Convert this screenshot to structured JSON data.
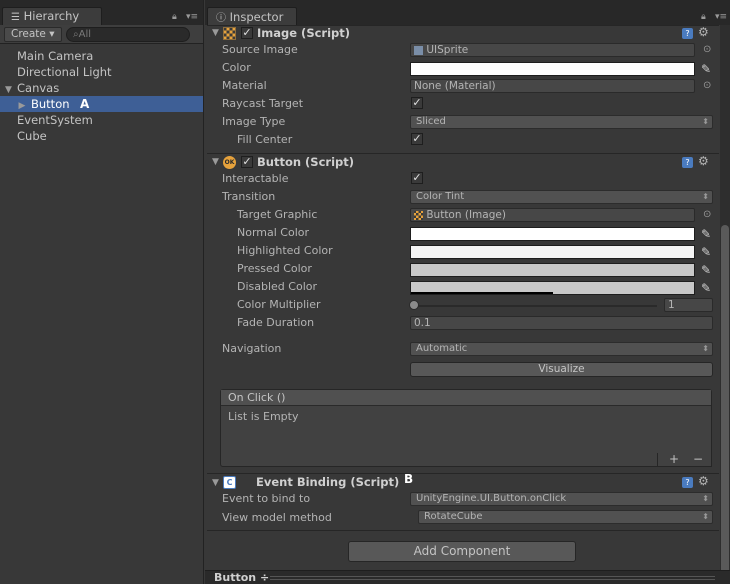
{
  "hierarchy": {
    "tab_label": "Hierarchy",
    "create_label": "Create ▾",
    "search_placeholder": "All",
    "items": [
      {
        "label": "Main Camera"
      },
      {
        "label": "Directional Light"
      },
      {
        "label": "Canvas"
      },
      {
        "label": "Button"
      },
      {
        "label": "EventSystem"
      },
      {
        "label": "Cube"
      }
    ],
    "callout_a": "A"
  },
  "inspector": {
    "tab_label": "Inspector",
    "image_component": {
      "title": "Image (Script)",
      "source_image_label": "Source Image",
      "source_image_value": "UISprite",
      "color_label": "Color",
      "color_value": "#ffffff",
      "material_label": "Material",
      "material_value": "None (Material)",
      "raycast_label": "Raycast Target",
      "image_type_label": "Image Type",
      "image_type_value": "Sliced",
      "fill_center_label": "Fill Center"
    },
    "button_component": {
      "title": "Button (Script)",
      "interactable_label": "Interactable",
      "transition_label": "Transition",
      "transition_value": "Color Tint",
      "target_graphic_label": "Target Graphic",
      "target_graphic_value": "Button (Image)",
      "normal_color_label": "Normal Color",
      "highlighted_color_label": "Highlighted Color",
      "pressed_color_label": "Pressed Color",
      "disabled_color_label": "Disabled Color",
      "color_multiplier_label": "Color Multiplier",
      "color_multiplier_value": "1",
      "fade_duration_label": "Fade Duration",
      "fade_duration_value": "0.1",
      "navigation_label": "Navigation",
      "navigation_value": "Automatic",
      "visualize_label": "Visualize",
      "onclick_title": "On Click ()",
      "onclick_empty": "List is Empty",
      "add_label": "+",
      "remove_label": "−"
    },
    "event_binding_component": {
      "title": "Event Binding (Script)",
      "callout_b": "B",
      "event_label": "Event to bind to",
      "event_value": "UnityEngine.UI.Button.onClick",
      "method_label": "View model method",
      "method_value": "RotateCube"
    },
    "add_component_label": "Add Component",
    "footer_label": "Button ÷"
  },
  "colors": {
    "normal": "#ffffff",
    "highlighted": "#f5f5f5",
    "pressed": "#c8c8c8",
    "disabled": "#c8c8c8",
    "selection": "#3e5f96"
  }
}
